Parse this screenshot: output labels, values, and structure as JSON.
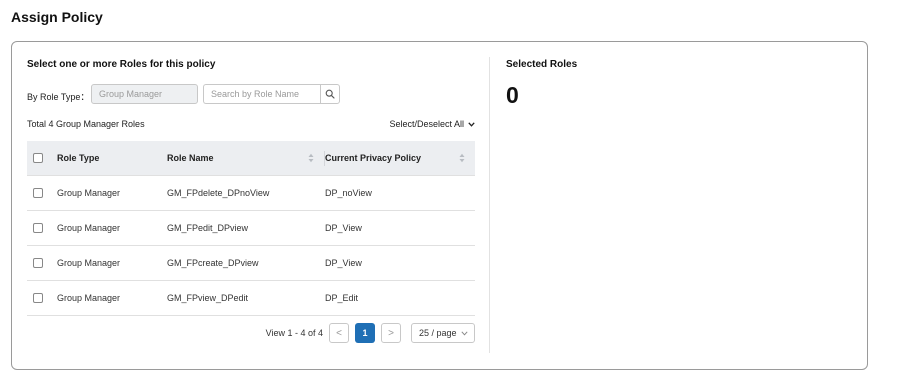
{
  "page": {
    "title": "Assign Policy"
  },
  "left": {
    "title": "Select one or more Roles for this policy",
    "filter_label": "By Role Type：",
    "role_type_value": "Group Manager",
    "search_placeholder": "Search by Role Name",
    "total_text": "Total 4 Group Manager Roles",
    "select_all_label": "Select/Deselect All"
  },
  "table": {
    "columns": [
      "Role Type",
      "Role Name",
      "Current Privacy Policy"
    ],
    "rows": [
      {
        "role_type": "Group Manager",
        "role_name": "GM_FPdelete_DPnoView",
        "policy": "DP_noView"
      },
      {
        "role_type": "Group Manager",
        "role_name": "GM_FPedit_DPview",
        "policy": "DP_View"
      },
      {
        "role_type": "Group Manager",
        "role_name": "GM_FPcreate_DPview",
        "policy": "DP_View"
      },
      {
        "role_type": "Group Manager",
        "role_name": "GM_FPview_DPedit",
        "policy": "DP_Edit"
      }
    ]
  },
  "pagination": {
    "range_text": "View 1 - 4 of 4",
    "prev": "<",
    "current_page": "1",
    "next": ">",
    "page_size": "25 / page"
  },
  "right": {
    "title": "Selected Roles",
    "count": "0"
  },
  "icons": {
    "search": "search-icon",
    "chevron": "chevron-down-icon",
    "sort": "sort-icon"
  },
  "colors": {
    "accent": "#1f6fb5",
    "header_bg": "#eceef1"
  }
}
